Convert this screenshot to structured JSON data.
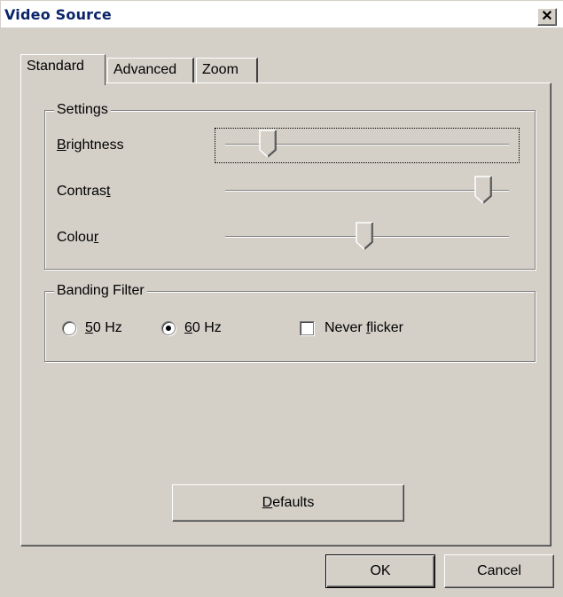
{
  "window": {
    "title": "Video Source",
    "close_glyph": "✕"
  },
  "tabs": [
    {
      "label": "Standard",
      "active": true
    },
    {
      "label": "Advanced",
      "active": false
    },
    {
      "label": "Zoom",
      "active": false
    }
  ],
  "settings": {
    "legend": "Settings",
    "sliders": [
      {
        "label_pre": "",
        "mnemonic": "B",
        "label_post": "rightness",
        "value": 0.15,
        "focused": true
      },
      {
        "label_pre": "Contras",
        "mnemonic": "t",
        "label_post": "",
        "value": 0.91,
        "focused": false
      },
      {
        "label_pre": "Colou",
        "mnemonic": "r",
        "label_post": "",
        "value": 0.49,
        "focused": false
      }
    ]
  },
  "banding": {
    "legend": "Banding Filter",
    "options": [
      {
        "mnemonic": "5",
        "rest": "0 Hz",
        "checked": false
      },
      {
        "mnemonic": "6",
        "rest": "0 Hz",
        "checked": true
      }
    ],
    "checkbox": {
      "label_pre": "Never ",
      "mnemonic": "f",
      "label_post": "licker",
      "checked": false
    }
  },
  "buttons": {
    "defaults": {
      "mnemonic": "D",
      "rest": "efaults"
    },
    "ok": "OK",
    "cancel": "Cancel"
  },
  "icons": {
    "close": "close-icon",
    "slider_thumb": "slider-thumb-icon"
  },
  "colors": {
    "face": "#d4d0c8",
    "title_text": "#0a246a"
  }
}
